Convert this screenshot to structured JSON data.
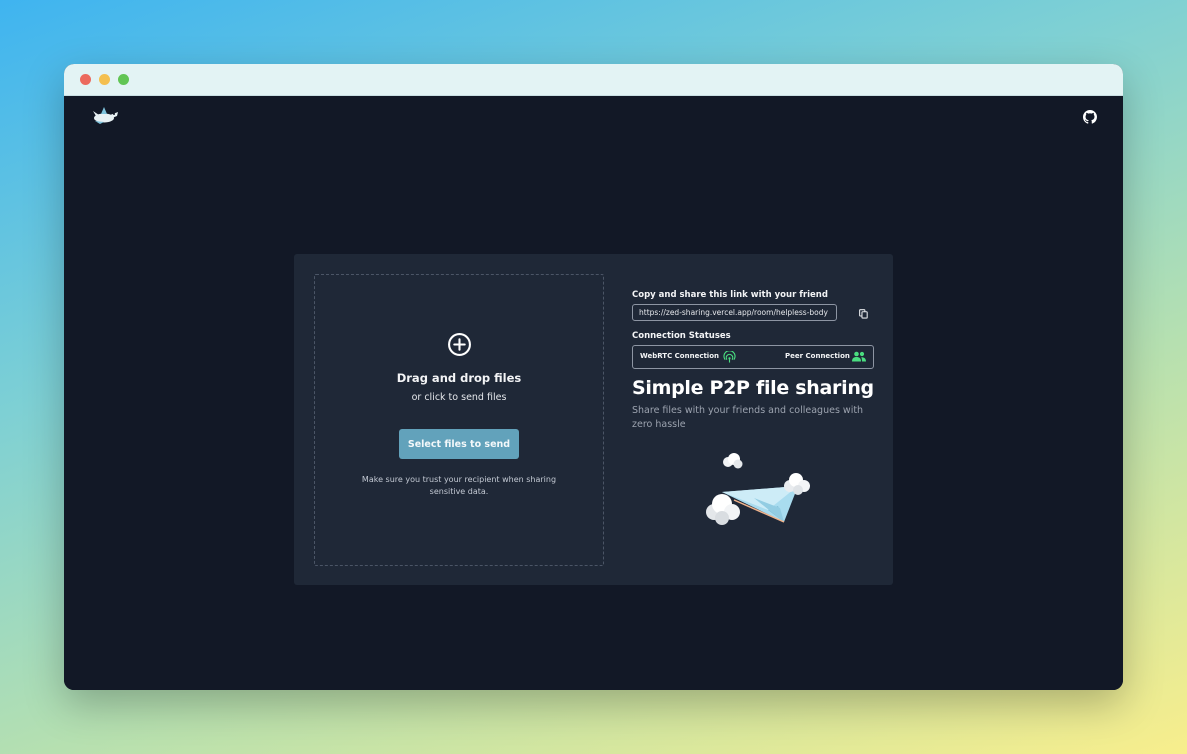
{
  "app": {
    "logo_icon": "bird-logo-icon",
    "github_icon": "github-icon"
  },
  "dropzone": {
    "plus_icon": "plus-circle-icon",
    "title": "Drag and drop files",
    "subtitle": "or click to send files",
    "button_label": "Select files to send",
    "note": "Make sure you trust your recipient when sharing sensitive data."
  },
  "share": {
    "label": "Copy and share this link with your friend",
    "link_value": "https://zed-sharing.vercel.app/room/helpless-body",
    "copy_icon": "copy-icon"
  },
  "connection": {
    "label": "Connection Statuses",
    "webrtc_label": "WebRTC Connection",
    "webrtc_icon": "wifi-signal-icon",
    "peer_label": "Peer Connection",
    "peer_icon": "users-icon",
    "status_color": "#4ade80"
  },
  "hero": {
    "title": "Simple P2P file sharing",
    "description": "Share files with your friends and colleagues with zero hassle",
    "illustration": "paper-plane-clouds-illustration"
  },
  "colors": {
    "app_background": "#121826",
    "card_background": "#1f2837",
    "button_background": "#62a2bb"
  }
}
